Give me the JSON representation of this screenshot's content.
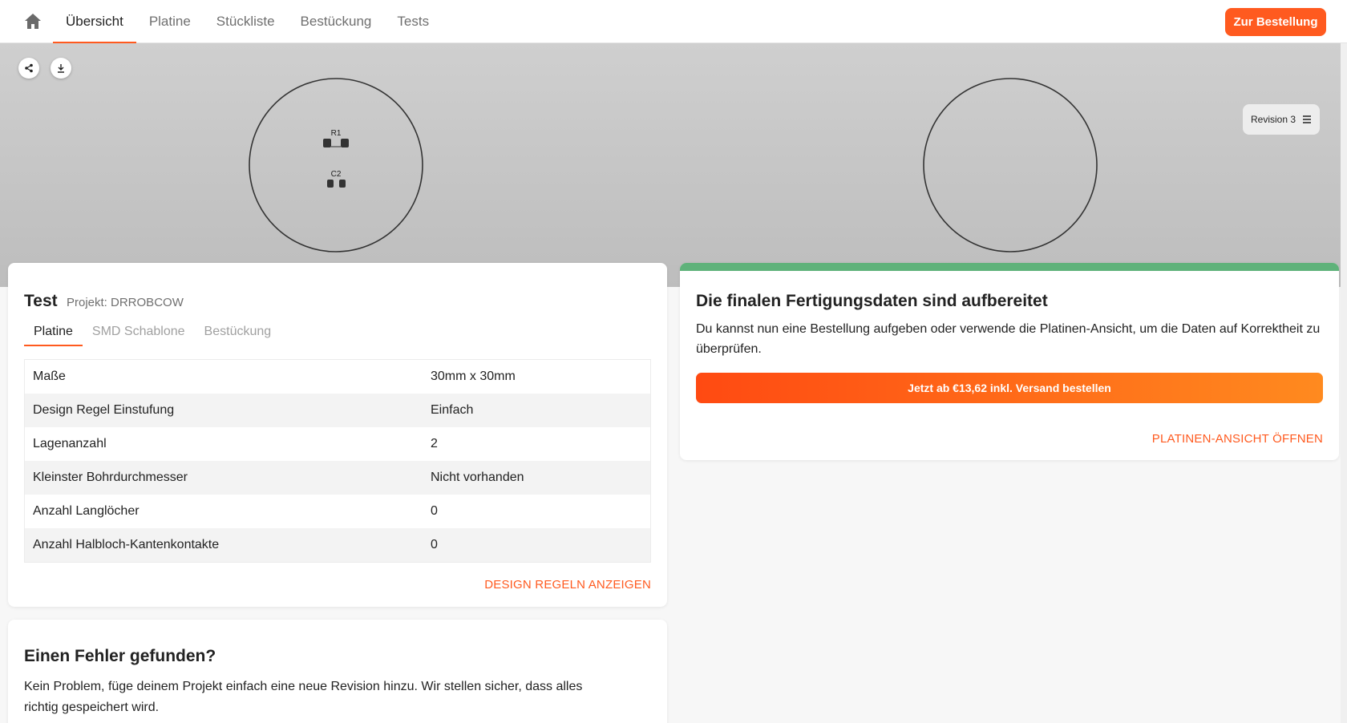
{
  "nav": {
    "tabs": [
      {
        "label": "Übersicht"
      },
      {
        "label": "Platine"
      },
      {
        "label": "Stückliste"
      },
      {
        "label": "Bestückung"
      },
      {
        "label": "Tests"
      }
    ],
    "order_button": "Zur Bestellung"
  },
  "viewer": {
    "revision_label": "Revision 3",
    "components": [
      {
        "ref": "R1"
      },
      {
        "ref": "C2"
      }
    ]
  },
  "project": {
    "title": "Test",
    "subtitle": "Projekt: DRROBCOW",
    "tabs": [
      {
        "label": "Platine"
      },
      {
        "label": "SMD Schablone"
      },
      {
        "label": "Bestückung"
      }
    ],
    "specs": [
      {
        "label": "Maße",
        "value": "30mm x 30mm"
      },
      {
        "label": "Design Regel Einstufung",
        "value": "Einfach"
      },
      {
        "label": "Lagenanzahl",
        "value": "2"
      },
      {
        "label": "Kleinster Bohrdurchmesser",
        "value": "Nicht vorhanden"
      },
      {
        "label": "Anzahl Langlöcher",
        "value": "0"
      },
      {
        "label": "Anzahl Halbloch-Kantenkontakte",
        "value": "0"
      }
    ],
    "design_rules_link": "DESIGN REGELN ANZEIGEN"
  },
  "status_card": {
    "title": "Die finalen Fertigungsdaten sind aufbereitet",
    "text": "Du kannst nun eine Bestellung aufgeben oder verwende die Platinen-Ansicht, um die Daten auf Korrektheit zu überprüfen.",
    "cta": "Jetzt ab €13,62 inkl. Versand bestellen",
    "link": "PLATINEN-ANSICHT ÖFFNEN",
    "accent_color": "#5fb27a"
  },
  "error_card": {
    "title": "Einen Fehler gefunden?",
    "text": "Kein Problem, füge deinem Projekt einfach eine neue Revision hinzu. Wir stellen sicher, dass alles richtig gespeichert wird."
  },
  "colors": {
    "brand": "#ff5a1f",
    "success": "#5fb27a"
  }
}
